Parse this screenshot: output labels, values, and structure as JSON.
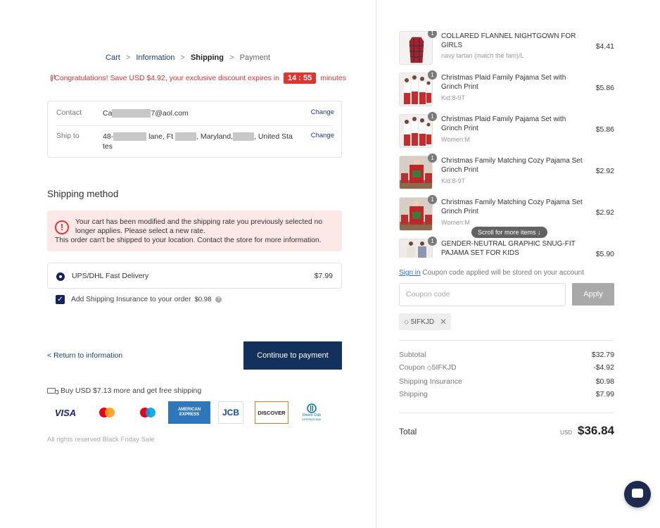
{
  "breadcrumb": {
    "cart": "Cart",
    "information": "Information",
    "shipping": "Shipping",
    "payment": "Payment",
    "sep": ">"
  },
  "promo": {
    "text": "Congratulations! Save  USD $4.92, your exclusive discount expires in",
    "timer": "14 : 55",
    "suffix": "minutes"
  },
  "contact": {
    "label": "Contact",
    "value_start": "Ca",
    "value_end": "7@aol.com",
    "change": "Change"
  },
  "ship_to": {
    "label": "Ship to",
    "part1": "48-",
    "part2": "lane, Ft",
    "part3": ", Maryland,",
    "part4": ", United Sta",
    "part5": "tes",
    "change": "Change"
  },
  "shipping_method": {
    "title": "Shipping method",
    "warning_line1": "Your cart has been modified and the shipping rate you previously selected no",
    "warning_line2": "longer applies. Please select a new rate.",
    "warning_line3": "This order can't be shipped to your location. Contact the store for more information.",
    "option_label": "UPS/DHL Fast Delivery",
    "option_price": "$7.99",
    "insurance_label": "Add Shipping Insurance to your order",
    "insurance_price": "$0.98"
  },
  "actions": {
    "return": "Return to information",
    "return_chevron": "<",
    "continue": "Continue to payment"
  },
  "free_shipping": "Buy USD $7.13 more and get free shipping",
  "payment_icons": {
    "visa": "VISA",
    "amex_line1": "AMERICAN",
    "amex_line2": "EXPRESS",
    "jcb": "JCB",
    "discover": "DISCOVER",
    "diners_line1": "Diners Club",
    "diners_line2": "INTERNATIONAL"
  },
  "footer": "All rights reserved  Black Friday Sale",
  "items": [
    {
      "qty": "1",
      "name": "COLLARED FLANNEL NIGHTGOWN FOR GIRLS",
      "variant": "navy tartan (match the fam)/L",
      "price": "$4.41"
    },
    {
      "qty": "1",
      "name": "Christmas Plaid Family Pajama Set with Grinch Print",
      "variant": "Kid:8-9T",
      "price": "$5.86"
    },
    {
      "qty": "1",
      "name": "Christmas Plaid Family Pajama Set with Grinch Print",
      "variant": "Women:M",
      "price": "$5.86"
    },
    {
      "qty": "1",
      "name": "Christmas Family Matching Cozy Pajama Set Grinch Print",
      "variant": "Kid:8-9T",
      "price": "$2.92"
    },
    {
      "qty": "1",
      "name": "Christmas Family Matching Cozy Pajama Set Grinch Print",
      "variant": "Women:M",
      "price": "$2.92"
    },
    {
      "qty": "1",
      "name": "GENDER-NEUTRAL GRAPHIC SNUG-FIT PAJAMA SET FOR KIDS",
      "variant": "",
      "price": "$5.90"
    }
  ],
  "scroll_tip": "Scroll for more items ↓",
  "coupon": {
    "signin": "Sign in",
    "signin_note": " Coupon code applied will be stored on your account",
    "placeholder": "Coupon code",
    "apply": "Apply",
    "tag": "5IFKJD",
    "tag_remove": "✕"
  },
  "summary": {
    "subtotal_label": "Subtotal",
    "subtotal": "$32.79",
    "coupon_label": "Coupon",
    "coupon_code": "5IFKJD",
    "coupon_value": "-$4.92",
    "insurance_label": "Shipping Insurance",
    "insurance": "$0.98",
    "shipping_label": "Shipping",
    "shipping": "$7.99",
    "total_label": "Total",
    "currency": "USD",
    "total": "$36.84"
  }
}
